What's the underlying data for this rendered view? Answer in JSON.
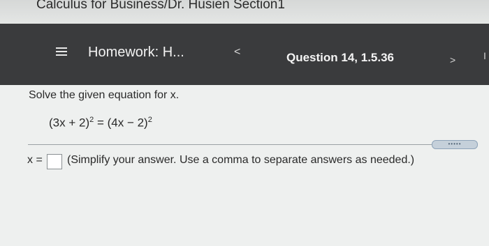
{
  "course": {
    "title": "Calculus for Business/Dr. Husien Section1"
  },
  "nav": {
    "menu_icon": "hamburger-menu-icon",
    "homework_title": "Homework: H...",
    "prev_symbol": "<",
    "question_label": "Question 14, 1.5.36",
    "next_symbol": ">",
    "edge_glyph": "I"
  },
  "question": {
    "instruction": "Solve the given equation for x.",
    "equation": {
      "lhs_base": "(3x + 2)",
      "lhs_exp": "2",
      "equals": " = ",
      "rhs_base": "(4x − 2)",
      "rhs_exp": "2"
    },
    "more_button": "•••••"
  },
  "answer": {
    "prefix": "x =",
    "value": "",
    "hint": "(Simplify your answer. Use a comma to separate answers as needed.)"
  },
  "colors": {
    "nav_background": "#3a3b3d",
    "page_background": "#eef0ef"
  }
}
